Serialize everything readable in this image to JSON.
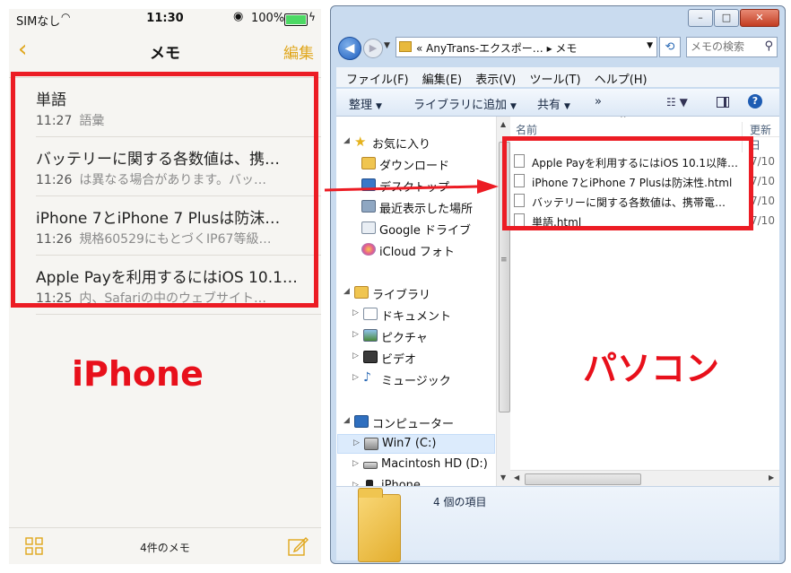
{
  "iphone": {
    "status": {
      "carrier": "SIMなし",
      "time": "11:30",
      "battery": "100%"
    },
    "nav": {
      "back": "‹",
      "title": "メモ",
      "edit": "編集"
    },
    "notes": [
      {
        "title": "単語",
        "time": "11:27",
        "preview": "語彙"
      },
      {
        "title": "バッテリーに関する各数値は、携…",
        "time": "11:26",
        "preview": "は異なる場合があります。バッ…"
      },
      {
        "title": "iPhone 7とiPhone 7 Plusは防沫…",
        "time": "11:26",
        "preview": "規格60529にもとづくIP67等級…"
      },
      {
        "title": "Apple Payを利用するにはiOS 10.1…",
        "time": "11:25",
        "preview": "内、Safariの中のウェブサイト…"
      }
    ],
    "toolbar": {
      "count": "4件のメモ"
    },
    "label": "iPhone"
  },
  "explorer": {
    "address": {
      "crumb": "« AnyTrans-エクスポー… ▸ メモ"
    },
    "search": {
      "placeholder": "メモの検索"
    },
    "menu": [
      "ファイル(F)",
      "編集(E)",
      "表示(V)",
      "ツール(T)",
      "ヘルプ(H)"
    ],
    "commands": {
      "organize": "整理",
      "add_library": "ライブラリに追加",
      "share": "共有",
      "more": "»"
    },
    "nav": {
      "favorites": "お気に入り",
      "downloads": "ダウンロード",
      "desktop": "デスクトップ",
      "recent": "最近表示した場所",
      "gdrive": "Google ドライブ",
      "icloud": "iCloud フォト",
      "libraries": "ライブラリ",
      "documents": "ドキュメント",
      "pictures": "ピクチャ",
      "videos": "ビデオ",
      "music": "ミュージック",
      "computer": "コンピューター",
      "win7": "Win7 (C:)",
      "mac": "Macintosh HD (D:)",
      "iphone": "iPhone"
    },
    "columns": {
      "name": "名前",
      "date": "更新日"
    },
    "files": [
      {
        "name": "Apple Payを利用するにはiOS 10.1以降…",
        "date": "7/10"
      },
      {
        "name": "iPhone 7とiPhone 7 Plusは防沫性.html",
        "date": "7/10"
      },
      {
        "name": "バッテリーに関する各数値は、携帯電…",
        "date": "7/10"
      },
      {
        "name": "単語.html",
        "date": "7/10"
      }
    ],
    "details": {
      "count": "4 個の項目"
    },
    "label": "パソコン"
  },
  "colors": {
    "highlight_red": "#ec1c24",
    "label_red": "#e8101b",
    "ios_accent": "#e0a61b"
  }
}
